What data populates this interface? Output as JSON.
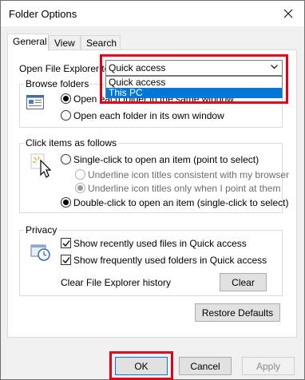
{
  "window": {
    "title": "Folder Options"
  },
  "tabs": [
    {
      "label": "General"
    },
    {
      "label": "View"
    },
    {
      "label": "Search"
    }
  ],
  "open_explorer": {
    "label": "Open File Explorer to:",
    "value": "Quick access",
    "options": [
      "Quick access",
      "This PC"
    ],
    "highlighted": "This PC"
  },
  "browse_folders": {
    "title": "Browse folders",
    "option1": "Open each folder in the same window",
    "option2": "Open each folder in its own window"
  },
  "click_items": {
    "title": "Click items as follows",
    "single_click": "Single-click to open an item (point to select)",
    "underline_consistent": "Underline icon titles consistent with my browser",
    "underline_point": "Underline icon titles only when I point at them",
    "double_click": "Double-click to open an item (single-click to select)"
  },
  "privacy": {
    "title": "Privacy",
    "recent_files": "Show recently used files in Quick access",
    "frequent_folders": "Show frequently used folders in Quick access",
    "clear_history_label": "Clear File Explorer history",
    "clear_button": "Clear"
  },
  "buttons": {
    "restore_defaults": "Restore Defaults",
    "ok": "OK",
    "cancel": "Cancel",
    "apply": "Apply"
  },
  "colors": {
    "highlight": "#e0001b",
    "selection": "#0078d7"
  }
}
